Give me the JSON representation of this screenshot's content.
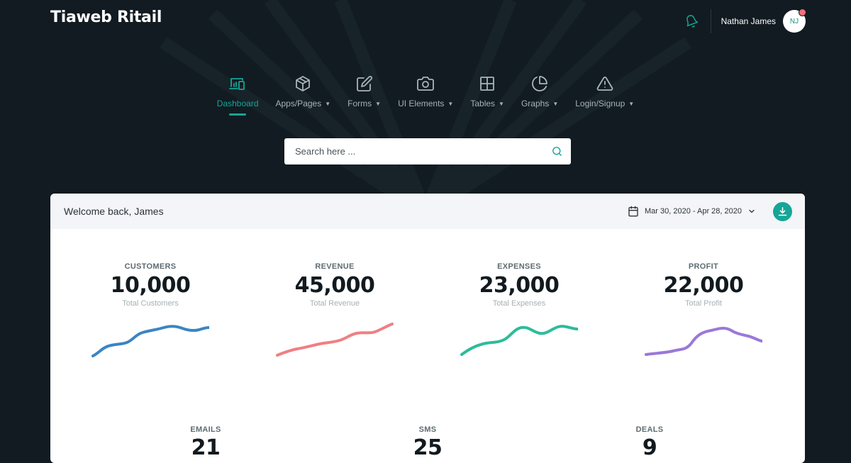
{
  "brand": "Tiaweb Ritail",
  "user": {
    "name": "Nathan James",
    "initials": "NJ"
  },
  "nav": [
    {
      "label": "Dashboard",
      "icon": "devices-icon",
      "active": true,
      "caret": false
    },
    {
      "label": "Apps/Pages",
      "icon": "cube-icon",
      "caret": true
    },
    {
      "label": "Forms",
      "icon": "edit-icon",
      "caret": true
    },
    {
      "label": "UI Elements",
      "icon": "camera-icon",
      "caret": true
    },
    {
      "label": "Tables",
      "icon": "grid-icon",
      "caret": true
    },
    {
      "label": "Graphs",
      "icon": "pie-chart-icon",
      "caret": true
    },
    {
      "label": "Login/Signup",
      "icon": "alert-triangle-icon",
      "caret": true
    }
  ],
  "search": {
    "placeholder": "Search here ..."
  },
  "card": {
    "welcome": "Welcome back, James",
    "date_range": "Mar 30, 2020 - Apr 28, 2020"
  },
  "stats": [
    {
      "label": "CUSTOMERS",
      "value": "10,000",
      "sub": "Total Customers",
      "color": "#3a85c4"
    },
    {
      "label": "REVENUE",
      "value": "45,000",
      "sub": "Total Revenue",
      "color": "#f07f82"
    },
    {
      "label": "EXPENSES",
      "value": "23,000",
      "sub": "Total Expenses",
      "color": "#2dbc9a"
    },
    {
      "label": "PROFIT",
      "value": "22,000",
      "sub": "Total Profit",
      "color": "#9b78d8"
    }
  ],
  "stats2": [
    {
      "label": "EMAILS",
      "value": "21"
    },
    {
      "label": "SMS",
      "value": "25"
    },
    {
      "label": "DEALS",
      "value": "9"
    }
  ],
  "colors": {
    "accent": "#16a596",
    "background": "#111b21",
    "notification": "#f26d7d"
  }
}
